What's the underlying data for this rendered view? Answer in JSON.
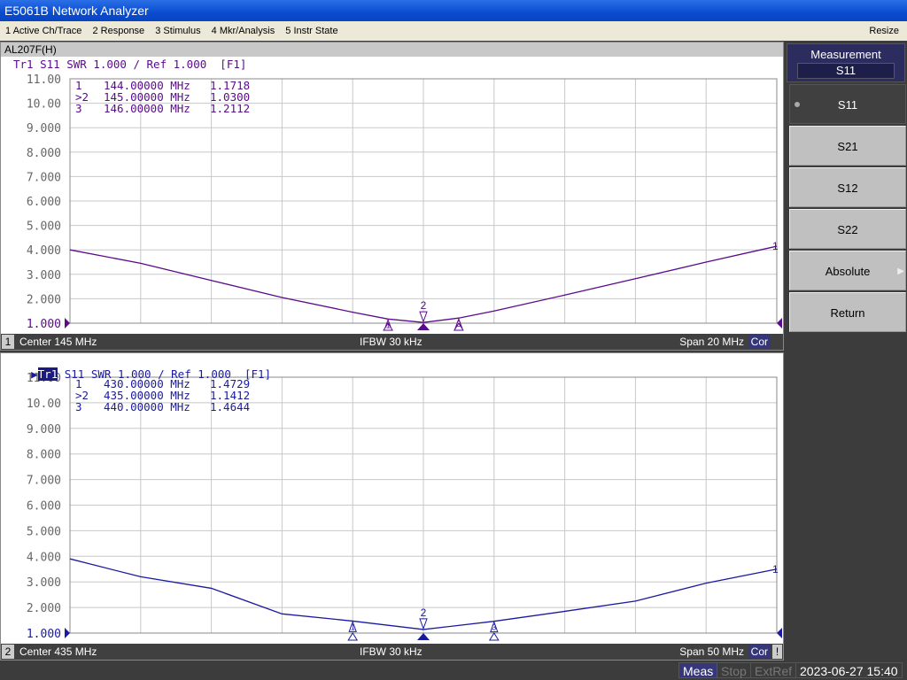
{
  "title": "E5061B Network Analyzer",
  "menu": [
    "1 Active Ch/Trace",
    "2 Response",
    "3 Stimulus",
    "4 Mkr/Analysis",
    "5 Instr State"
  ],
  "resize": "Resize",
  "window_title": "AL207F(H)",
  "softkeys": {
    "header": "Measurement",
    "header_value": "S11",
    "items": [
      {
        "label": "S11",
        "selected": true
      },
      {
        "label": "S21"
      },
      {
        "label": "S12"
      },
      {
        "label": "S22"
      },
      {
        "label": "Absolute",
        "submenu": true
      },
      {
        "label": "Return"
      }
    ]
  },
  "status": {
    "meas": "Meas",
    "stop": "Stop",
    "extref": "ExtRef",
    "datetime": "2023-06-27 15:40"
  },
  "colors": {
    "ch1_trace": "#5a0a8c",
    "ch2_trace": "#1a1aa0"
  },
  "channels": [
    {
      "num": "1",
      "trace_header": "Tr1 S11 SWR 1.000 / Ref 1.000  [F1]",
      "active": false,
      "center": "Center  145 MHz",
      "ifbw": "IFBW 30 kHz",
      "span": "Span 20 MHz",
      "cor": "Cor",
      "markers": [
        {
          "id": " 1",
          "freq": "144.00000 MHz",
          "value": "1.1718"
        },
        {
          "id": ">2",
          "freq": "145.00000 MHz",
          "value": "1.0300"
        },
        {
          "id": " 3",
          "freq": "146.00000 MHz",
          "value": "1.2112"
        }
      ]
    },
    {
      "num": "2",
      "trace_header": "S11 SWR 1.000 / Ref 1.000  [F1]",
      "trace_label": "Tr1",
      "active": true,
      "center": "Center  435 MHz",
      "ifbw": "IFBW 30 kHz",
      "span": "Span 50 MHz",
      "cor": "Cor",
      "warn": "!",
      "markers": [
        {
          "id": " 1",
          "freq": "430.00000 MHz",
          "value": "1.4729"
        },
        {
          "id": ">2",
          "freq": "435.00000 MHz",
          "value": "1.1412"
        },
        {
          "id": " 3",
          "freq": "440.00000 MHz",
          "value": "1.4644"
        }
      ]
    }
  ],
  "chart_data": [
    {
      "type": "line",
      "ylim": [
        1,
        11
      ],
      "xlim": [
        135,
        155
      ],
      "grid": true,
      "yticks": [
        "11.00",
        "10.00",
        "9.000",
        "8.000",
        "7.000",
        "6.000",
        "5.000",
        "4.000",
        "3.000",
        "2.000",
        "1.000"
      ],
      "x": [
        135,
        137,
        139,
        141,
        143,
        144,
        145,
        146,
        147,
        149,
        151,
        153,
        155
      ],
      "y": [
        4.0,
        3.45,
        2.75,
        2.05,
        1.45,
        1.17,
        1.03,
        1.21,
        1.5,
        2.15,
        2.82,
        3.5,
        4.15
      ],
      "marker_x": [
        144,
        145,
        146
      ],
      "marker_y": [
        1.1718,
        1.03,
        1.2112
      ],
      "trace_end_label": "1"
    },
    {
      "type": "line",
      "ylim": [
        1,
        11
      ],
      "xlim": [
        410,
        460
      ],
      "grid": true,
      "yticks": [
        "11.00",
        "10.00",
        "9.000",
        "8.000",
        "7.000",
        "6.000",
        "5.000",
        "4.000",
        "3.000",
        "2.000",
        "1.000"
      ],
      "x": [
        410,
        415,
        420,
        425,
        430,
        435,
        440,
        445,
        450,
        455,
        460
      ],
      "y": [
        3.9,
        3.2,
        2.75,
        1.75,
        1.47,
        1.14,
        1.46,
        1.85,
        2.25,
        2.95,
        3.5
      ],
      "marker_x": [
        430,
        435,
        440
      ],
      "marker_y": [
        1.4729,
        1.1412,
        1.4644
      ],
      "trace_end_label": "1"
    }
  ]
}
